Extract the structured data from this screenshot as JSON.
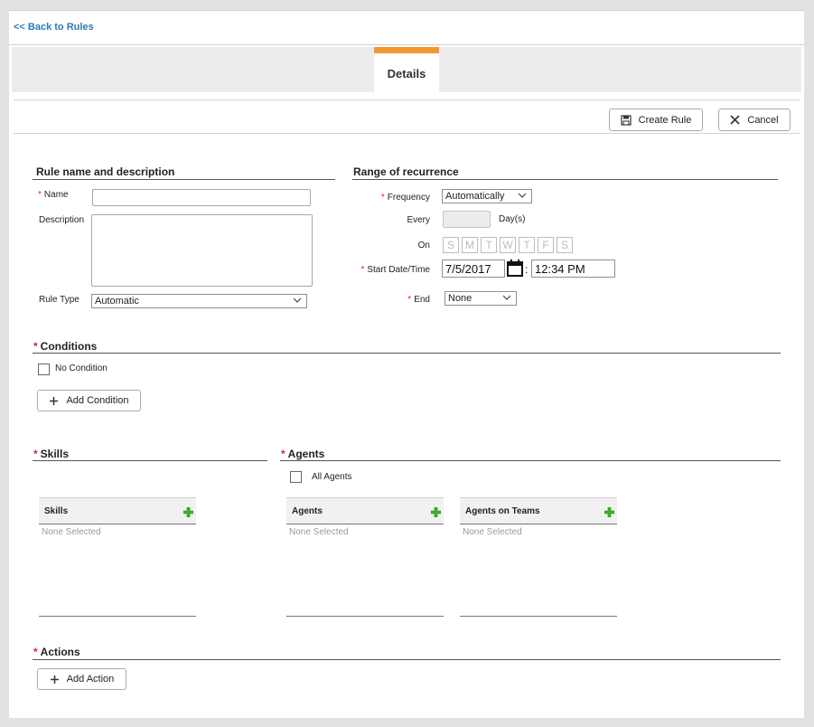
{
  "nav": {
    "back_label": "<< Back to Rules"
  },
  "tabs": [
    {
      "label": "Details",
      "active": true
    }
  ],
  "toolbar": {
    "create_label": "Create Rule",
    "cancel_label": "Cancel"
  },
  "rule": {
    "section_title": "Rule name and description",
    "name_label": "Name",
    "name_value": "",
    "description_label": "Description",
    "description_value": "",
    "type_label": "Rule Type",
    "type_value": "Automatic"
  },
  "recurrence": {
    "section_title": "Range of recurrence",
    "frequency_label": "Frequency",
    "frequency_value": "Automatically",
    "every_label": "Every",
    "every_value": "",
    "every_unit": "Day(s)",
    "on_label": "On",
    "days": [
      "S",
      "M",
      "T",
      "W",
      "T",
      "F",
      "S"
    ],
    "start_label": "Start Date/Time",
    "start_date": "7/5/2017",
    "time_separator": ":",
    "start_time": "12:34 PM",
    "end_label": "End",
    "end_value": "None"
  },
  "conditions": {
    "title": "Conditions",
    "no_condition_label": "No Condition",
    "add_label": "Add Condition"
  },
  "skills": {
    "title": "Skills",
    "list_header": "Skills",
    "empty_text": "None Selected"
  },
  "agents": {
    "title": "Agents",
    "all_agents_label": "All Agents",
    "agents_header": "Agents",
    "agents_empty": "None Selected",
    "teams_header": "Agents on Teams",
    "teams_empty": "None Selected"
  },
  "actions": {
    "title": "Actions",
    "add_label": "Add Action"
  },
  "colors": {
    "accent_tab": "#f29833",
    "link": "#2b7bb9",
    "required": "#d62828",
    "add_icon": "#3cb521"
  }
}
